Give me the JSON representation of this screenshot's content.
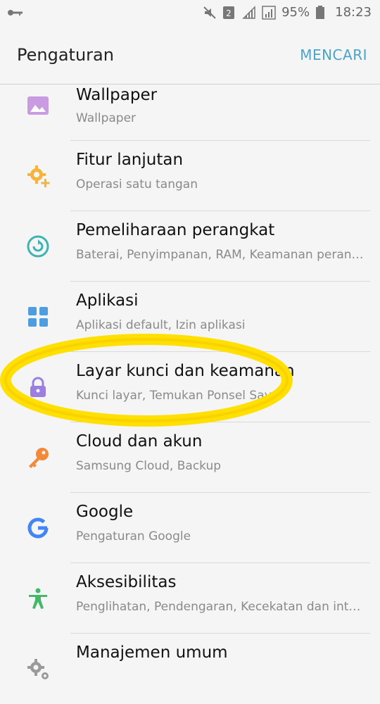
{
  "statusbar": {
    "battery": "95%",
    "time": "18:23",
    "sim_label": "2"
  },
  "appbar": {
    "title": "Pengaturan",
    "action": "MENCARI"
  },
  "items": [
    {
      "title": "Wallpaper",
      "subtitle": "Wallpaper",
      "icon": "wallpaper-icon",
      "color": "#c99be0"
    },
    {
      "title": "Fitur lanjutan",
      "subtitle": "Operasi satu tangan",
      "icon": "gear-plus-icon",
      "color": "#f5b53a"
    },
    {
      "title": "Pemeliharaan perangkat",
      "subtitle": "Baterai, Penyimpanan, RAM, Keamanan peran…",
      "icon": "device-maintenance-icon",
      "color": "#3fb3b0"
    },
    {
      "title": "Aplikasi",
      "subtitle": "Aplikasi default, Izin aplikasi",
      "icon": "apps-grid-icon",
      "color": "#4d9de0"
    },
    {
      "title": "Layar kunci dan keamanan",
      "subtitle": "Kunci layar, Temukan Ponsel Saya",
      "icon": "lock-icon",
      "color": "#9a7fe0"
    },
    {
      "title": "Cloud dan akun",
      "subtitle": "Samsung Cloud, Backup",
      "icon": "key-icon",
      "color": "#f28a3a"
    },
    {
      "title": "Google",
      "subtitle": "Pengaturan Google",
      "icon": "google-icon",
      "color": "#4285f4"
    },
    {
      "title": "Aksesibilitas",
      "subtitle": "Penglihatan, Pendengaran, Kecekatan dan int…",
      "icon": "accessibility-icon",
      "color": "#46b86b"
    },
    {
      "title": "Manajemen umum",
      "subtitle": "",
      "icon": "gears-icon",
      "color": "#9a9a9a"
    }
  ]
}
